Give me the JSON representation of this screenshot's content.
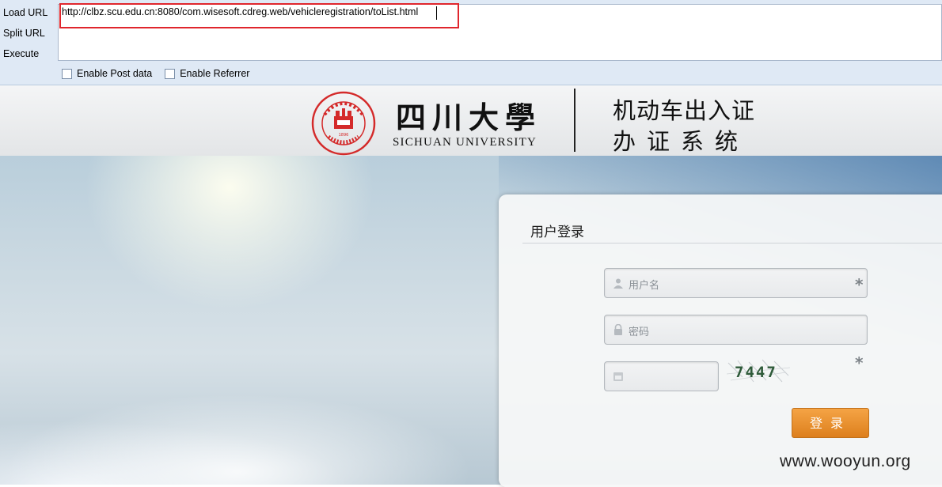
{
  "hackbar": {
    "menu": [
      {
        "label": "Load URL"
      },
      {
        "label": "Split URL"
      },
      {
        "label": "Execute"
      }
    ],
    "url_value": "http://clbz.scu.edu.cn:8080/com.wisesoft.cdreg.web/vehicleregistration/toList.html",
    "options": [
      {
        "label": "Enable Post data",
        "checked": false
      },
      {
        "label": "Enable Referrer",
        "checked": false
      }
    ]
  },
  "header": {
    "university_cn": "四川大學",
    "university_en": "SICHUAN UNIVERSITY",
    "system_line1": "机动车出入证",
    "system_line2": "办证系统",
    "seal_year": "1896",
    "seal_text": "SICHUAN UNIVERSITY"
  },
  "login": {
    "title": "用户登录",
    "username_placeholder": "用户名",
    "password_placeholder": "密码",
    "required_mark": "*",
    "captcha_text": "7447",
    "submit_label": "登录"
  },
  "watermark": "www.wooyun.org",
  "colors": {
    "accent_orange": "#e88a2a",
    "highlight_red": "#e0262d",
    "seal_red": "#d42a2a"
  }
}
